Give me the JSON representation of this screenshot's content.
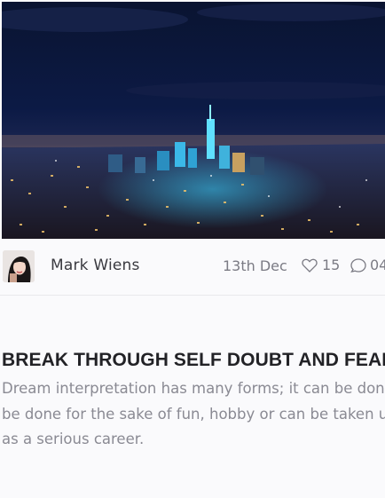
{
  "hero": {
    "image_name": "city-night-skyline-image"
  },
  "post": {
    "author": "Mark Wiens",
    "date": "13th Dec",
    "likes": "15",
    "comments": "04",
    "title": "BREAK THROUGH SELF DOUBT AND FEAR",
    "excerpt": "Dream interpretation has many forms; it can be done be done for the sake of fun, hobby or can be taken up as a serious career."
  },
  "icons": {
    "likes": "heart-icon",
    "comments": "comment-icon"
  },
  "colors": {
    "title": "#222226",
    "text_muted": "#8a8a93",
    "sky": "#0b1533",
    "city_glow": "#2ec8ff"
  }
}
